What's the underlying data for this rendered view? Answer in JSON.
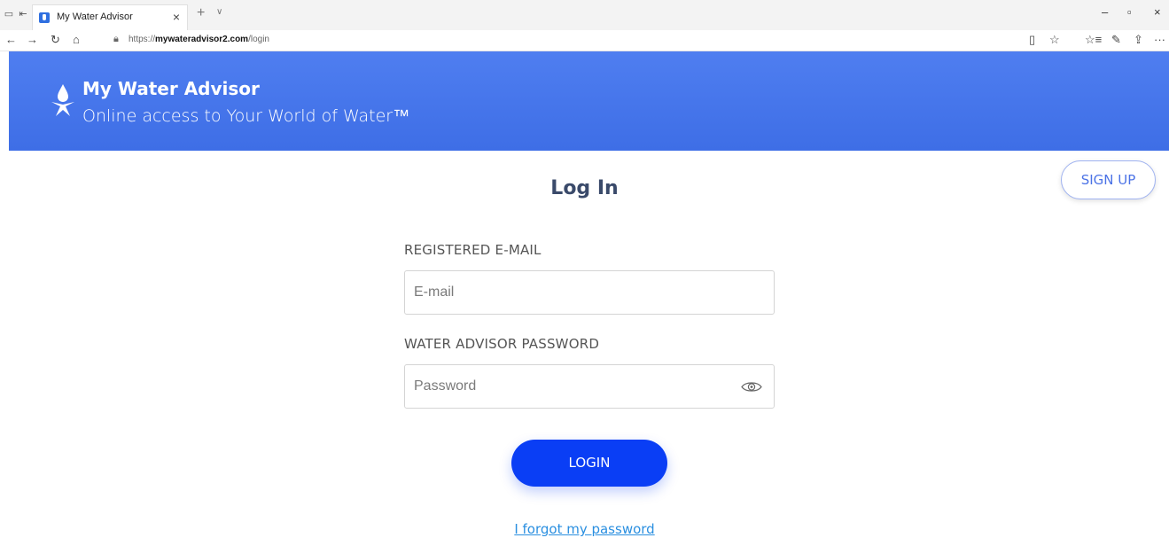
{
  "browser": {
    "tab_title": "My Water Advisor",
    "tab_close": "×",
    "new_tab": "+",
    "tab_list": "∨",
    "url_domain": "mywateradvisor2.com",
    "url_prefix": "https://",
    "url_path": "/login",
    "nav": {
      "back": "←",
      "forward": "→",
      "refresh": "↻",
      "home": "⌂"
    },
    "window": {
      "minimize": "–",
      "maximize": "▫",
      "close": "×"
    },
    "right_icons": {
      "reading_view": "▯",
      "favorite": "☆",
      "favorites_list": "☆≡",
      "notes": "✎",
      "share": "⇪",
      "more": "···"
    }
  },
  "header": {
    "brand_title": "My Water Advisor",
    "tagline": "Online access to Your World of Water™",
    "accent_color": "#4677ec"
  },
  "main": {
    "signup_label": "SIGN UP",
    "title": "Log In",
    "email_label": "REGISTERED E-MAIL",
    "email_placeholder": "E-mail",
    "email_value": "",
    "password_label": "WATER ADVISOR PASSWORD",
    "password_placeholder": "Password",
    "password_value": "",
    "login_label": "LOGIN",
    "forgot_label": "I forgot my password",
    "button_color": "#0a3ef5",
    "link_color": "#2a8fe0"
  }
}
